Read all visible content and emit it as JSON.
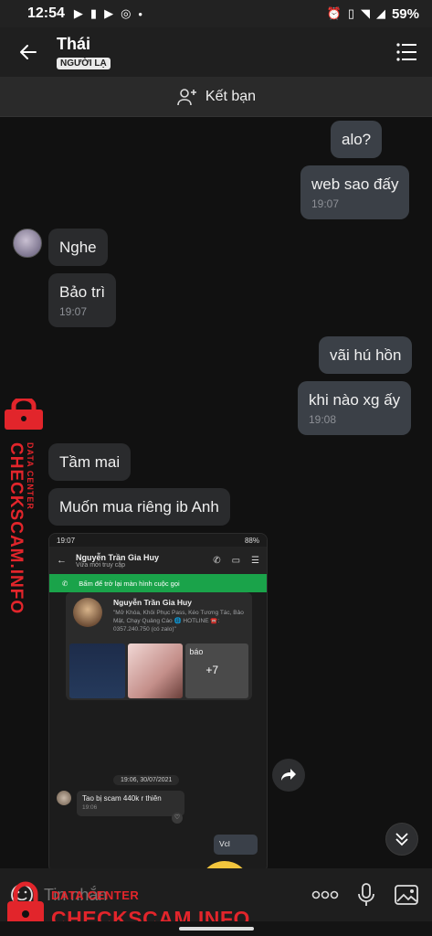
{
  "status_bar": {
    "time": "12:54",
    "battery": "59%"
  },
  "header": {
    "contact_name": "Thái",
    "badge": "NGƯỜI LẠ"
  },
  "friend_bar": {
    "label": "Kết bạn"
  },
  "messages": [
    {
      "side": "me",
      "text": "alo?",
      "time": ""
    },
    {
      "side": "me",
      "text": "web sao đấy",
      "time": "19:07"
    },
    {
      "side": "them",
      "text": "Nghe",
      "time": ""
    },
    {
      "side": "them",
      "text": "Bảo trì",
      "time": "19:07"
    },
    {
      "side": "me",
      "text": "vãi hú hồn",
      "time": ""
    },
    {
      "side": "me",
      "text": "khi nào xg ấy",
      "time": "19:08"
    },
    {
      "side": "them",
      "text": "Tầm mai",
      "time": ""
    },
    {
      "side": "them",
      "text": "Muốn mua riêng ib Anh",
      "time": ""
    }
  ],
  "screenshot": {
    "status_time": "19:07",
    "status_battery": "88%",
    "name": "Nguyễn Trần Gia Huy",
    "sub": "Vừa mới truy cập",
    "call_banner": "Bấm để trở lại màn hình cuộc gọi",
    "card_name": "Nguyễn Trần Gia Huy",
    "card_desc": "\"Mở Khóa, Khôi Phục Pass, Kéo Tương Tác, Bảo Mật, Chạy Quảng Cáo 🌐 HOTLINE ☎️: 0357.240.750 (có zalo)\"",
    "card_thumb_label": "báo",
    "card_thumb_more": "+7",
    "date": "19:06, 30/07/2021",
    "msg_text": "Tao bị scam 440k r thiên",
    "msg_time": "19:06",
    "reply_text": "Vcl"
  },
  "input": {
    "placeholder": "Tin nhắn"
  },
  "watermark": {
    "main": "CHECKSCAM.INFO",
    "sub": "DATA CENTER"
  },
  "colors": {
    "watermark": "#e2252b",
    "call_banner": "#1aa34a"
  }
}
